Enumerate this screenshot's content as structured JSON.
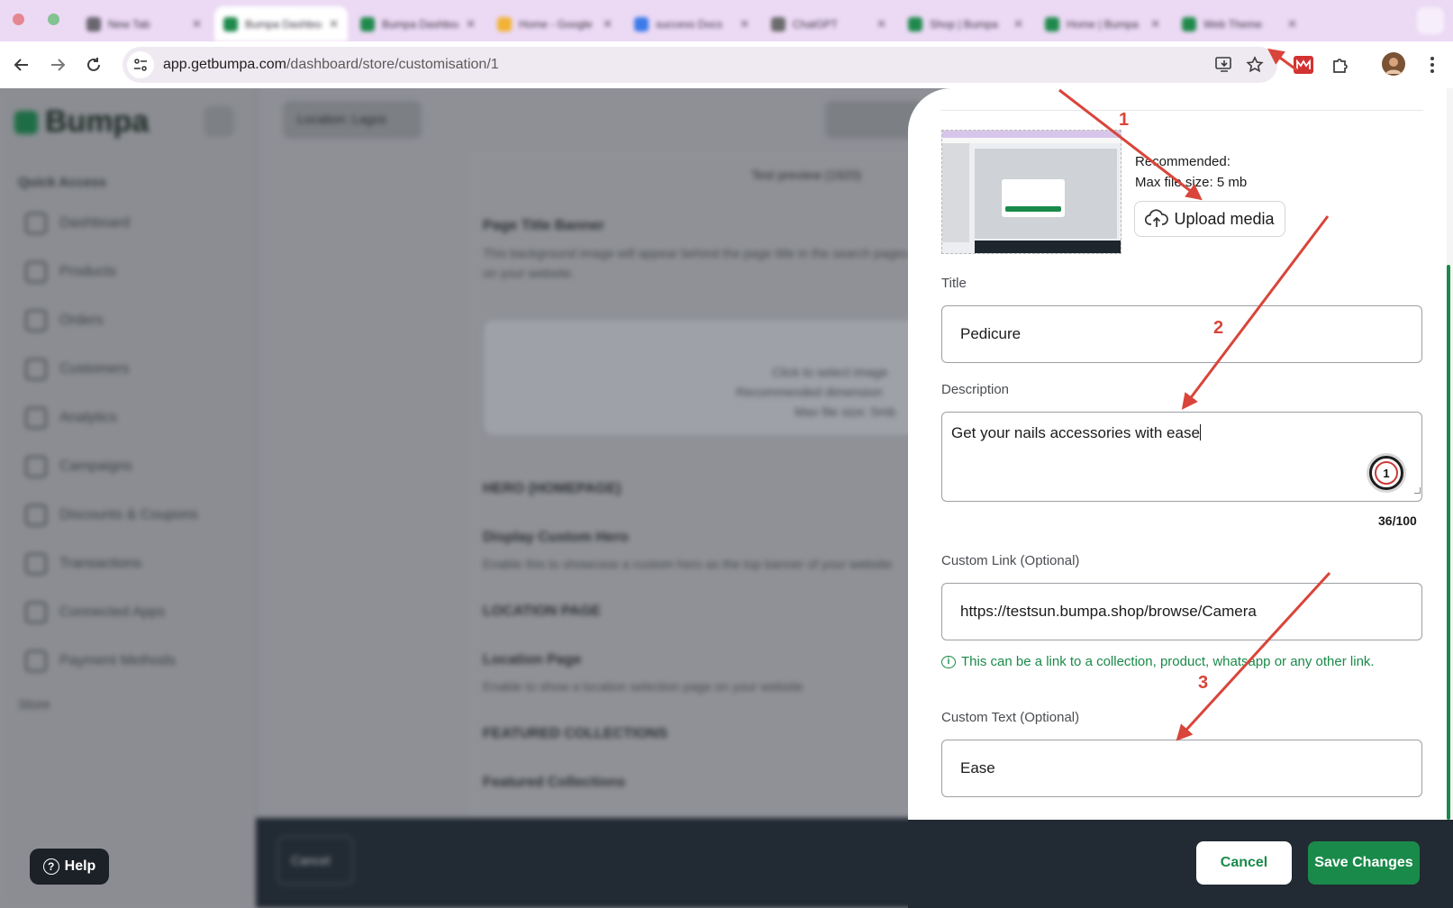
{
  "browser": {
    "tabs": [
      {
        "title": "New Tab",
        "favicon_color": "#6a6670"
      },
      {
        "title": "Bumpa Dashboard",
        "favicon_color": "#1f8a4c",
        "active": true
      },
      {
        "title": "Bumpa Dashboard",
        "favicon_color": "#1f8a4c"
      },
      {
        "title": "Home - Google Drive",
        "favicon_color": "#f2b233"
      },
      {
        "title": "success Docs",
        "favicon_color": "#3b7ae8"
      },
      {
        "title": "ChatGPT",
        "favicon_color": "#6b6b6b"
      },
      {
        "title": "Shop | Bumpa",
        "favicon_color": "#1f8a4c"
      },
      {
        "title": "Home | Bumpa",
        "favicon_color": "#1f8a4c"
      },
      {
        "title": "Web Theme",
        "favicon_color": "#1f8a4c"
      }
    ],
    "address": {
      "host": "app.getbumpa.com",
      "path": "/dashboard/store/customisation/1"
    }
  },
  "background_app": {
    "logo": "Bumpa",
    "section_label": "Quick Access",
    "nav_items": [
      "Dashboard",
      "Products",
      "Orders",
      "Customers",
      "Analytics",
      "Campaigns",
      "Discounts & Coupons",
      "Transactions",
      "Connected Apps",
      "Payment Methods"
    ],
    "store_label": "Store",
    "location_pill": "Location: Lagos",
    "preview_label": "Test preview (1920)",
    "main_sections": [
      {
        "title": "Page Title Banner",
        "subtitle": "This background image will appear behind the page title in the search pages on your website."
      },
      {
        "title": "HERO (HOMEPAGE)",
        "subtitle": ""
      },
      {
        "title": "Display Custom Hero",
        "subtitle": "Enable this to showcase a custom hero as the top banner of your website"
      },
      {
        "title": "LOCATION PAGE",
        "subtitle": ""
      },
      {
        "title": "Location Page",
        "subtitle": "Enable to show a location selection page on your website"
      },
      {
        "title": "FEATURED COLLECTIONS",
        "subtitle": ""
      },
      {
        "title": "Featured Collections",
        "subtitle": ""
      }
    ],
    "drop_zone": {
      "line1": "Click to select image",
      "line2": "Recommended dimension",
      "line3": "Max file size: 5mb"
    },
    "footer_cancel": "Cancel"
  },
  "help": {
    "label": "Help"
  },
  "drawer": {
    "recommended_label": "Recommended:",
    "max_size": "Max file size: 5 mb",
    "upload_button": "Upload media",
    "fields": {
      "title": {
        "label": "Title",
        "value": "Pedicure"
      },
      "description": {
        "label": "Description",
        "value": "Get your nails accessories with ease",
        "count": "36/100"
      },
      "link": {
        "label": "Custom Link (Optional)",
        "value": "https://testsun.bumpa.shop/browse/Camera",
        "hint": "This can be a link to a collection, product, whatsapp or any other link."
      },
      "text": {
        "label": "Custom Text (Optional)",
        "value": "Ease"
      }
    },
    "grammar_badge_count": "1",
    "footer": {
      "cancel": "Cancel",
      "save": "Save Changes"
    }
  },
  "annotations": {
    "numbers": [
      "1",
      "2",
      "3"
    ],
    "color": "#d9453a"
  },
  "colors": {
    "brand_green": "#1a8a4a",
    "footer_dark": "#222a33",
    "tabstrip": "#ecd9f4"
  }
}
